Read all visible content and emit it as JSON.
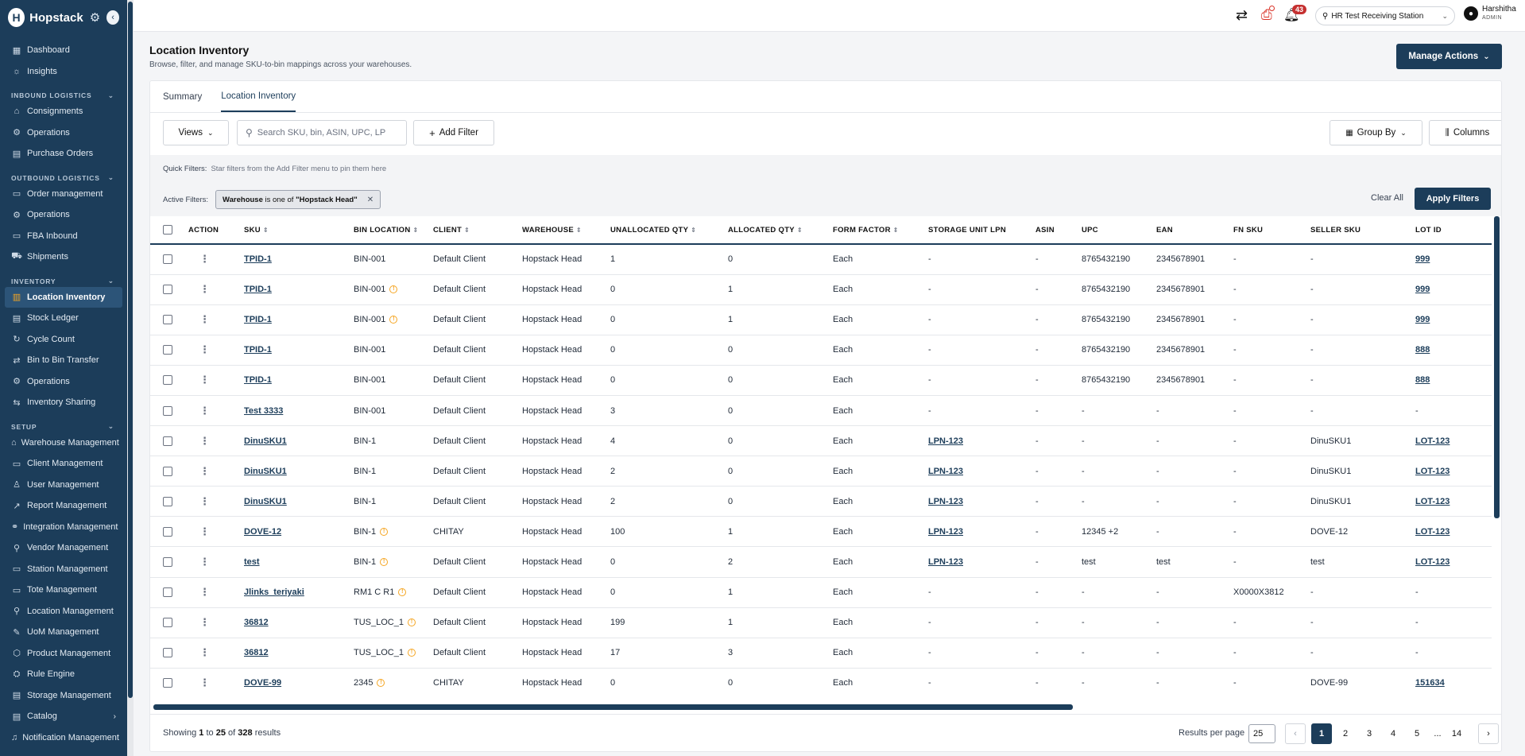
{
  "brand": {
    "name": "Hopstack"
  },
  "sidebar": {
    "top": [
      {
        "label": "Dashboard",
        "icon": "grid-icon"
      },
      {
        "label": "Insights",
        "icon": "bulb-icon"
      }
    ],
    "sections": [
      {
        "title": "INBOUND LOGISTICS",
        "items": [
          "Consignments",
          "Operations",
          "Purchase Orders"
        ]
      },
      {
        "title": "OUTBOUND LOGISTICS",
        "items": [
          "Order management",
          "Operations",
          "FBA Inbound",
          "Shipments"
        ]
      },
      {
        "title": "INVENTORY",
        "items": [
          "Location Inventory",
          "Stock Ledger",
          "Cycle Count",
          "Bin to Bin Transfer",
          "Operations",
          "Inventory Sharing"
        ]
      },
      {
        "title": "SETUP",
        "items": [
          "Warehouse Management",
          "Client Management",
          "User Management",
          "Report Management",
          "Integration Management",
          "Vendor Management",
          "Station Management",
          "Tote Management",
          "Location Management",
          "UoM Management",
          "Product Management",
          "Rule Engine",
          "Storage Management",
          "Catalog",
          "Notification Management"
        ]
      }
    ]
  },
  "topbar": {
    "notification_count": "43",
    "station": "HR Test Receiving Station",
    "user_name": "Harshitha",
    "user_role": "ADMIN"
  },
  "page": {
    "title": "Location Inventory",
    "subtitle": "Browse, filter, and manage SKU-to-bin mappings across your warehouses.",
    "manage_actions": "Manage Actions"
  },
  "tabs": [
    "Summary",
    "Location Inventory"
  ],
  "toolbar": {
    "views": "Views",
    "search_placeholder": "Search SKU, bin, ASIN, UPC, LP",
    "add_filter": "Add Filter",
    "group_by": "Group By",
    "columns": "Columns"
  },
  "filters": {
    "quick_label": "Quick Filters:",
    "quick_hint": "Star filters from the Add Filter menu to pin them here",
    "active_label": "Active Filters:",
    "chip_field": "Warehouse",
    "chip_op": "is one of",
    "chip_value": "\"Hopstack Head\"",
    "clear_all": "Clear All",
    "apply": "Apply Filters"
  },
  "table": {
    "headers": [
      "ACTION",
      "SKU",
      "BIN LOCATION",
      "CLIENT",
      "WAREHOUSE",
      "UNALLOCATED QTY",
      "ALLOCATED QTY",
      "FORM FACTOR",
      "STORAGE UNIT LPN",
      "ASIN",
      "UPC",
      "EAN",
      "FN SKU",
      "SELLER SKU",
      "LOT ID"
    ],
    "rows": [
      {
        "sku": "TPID-1",
        "bin": "BIN-001",
        "warn": false,
        "client": "Default Client",
        "warehouse": "Hopstack Head",
        "unalloc": "1",
        "alloc": "0",
        "form": "Each",
        "lpn": "-",
        "asin": "-",
        "upc": "8765432190",
        "ean": "2345678901",
        "fnsku": "-",
        "seller": "-",
        "lot": "999"
      },
      {
        "sku": "TPID-1",
        "bin": "BIN-001",
        "warn": true,
        "client": "Default Client",
        "warehouse": "Hopstack Head",
        "unalloc": "0",
        "alloc": "1",
        "form": "Each",
        "lpn": "-",
        "asin": "-",
        "upc": "8765432190",
        "ean": "2345678901",
        "fnsku": "-",
        "seller": "-",
        "lot": "999"
      },
      {
        "sku": "TPID-1",
        "bin": "BIN-001",
        "warn": true,
        "client": "Default Client",
        "warehouse": "Hopstack Head",
        "unalloc": "0",
        "alloc": "1",
        "form": "Each",
        "lpn": "-",
        "asin": "-",
        "upc": "8765432190",
        "ean": "2345678901",
        "fnsku": "-",
        "seller": "-",
        "lot": "999"
      },
      {
        "sku": "TPID-1",
        "bin": "BIN-001",
        "warn": false,
        "client": "Default Client",
        "warehouse": "Hopstack Head",
        "unalloc": "0",
        "alloc": "0",
        "form": "Each",
        "lpn": "-",
        "asin": "-",
        "upc": "8765432190",
        "ean": "2345678901",
        "fnsku": "-",
        "seller": "-",
        "lot": "888"
      },
      {
        "sku": "TPID-1",
        "bin": "BIN-001",
        "warn": false,
        "client": "Default Client",
        "warehouse": "Hopstack Head",
        "unalloc": "0",
        "alloc": "0",
        "form": "Each",
        "lpn": "-",
        "asin": "-",
        "upc": "8765432190",
        "ean": "2345678901",
        "fnsku": "-",
        "seller": "-",
        "lot": "888"
      },
      {
        "sku": "Test 3333",
        "bin": "BIN-001",
        "warn": false,
        "client": "Default Client",
        "warehouse": "Hopstack Head",
        "unalloc": "3",
        "alloc": "0",
        "form": "Each",
        "lpn": "-",
        "asin": "-",
        "upc": "-",
        "ean": "-",
        "fnsku": "-",
        "seller": "-",
        "lot": "-"
      },
      {
        "sku": "DinuSKU1",
        "bin": "BIN-1",
        "warn": false,
        "client": "Default Client",
        "warehouse": "Hopstack Head",
        "unalloc": "4",
        "alloc": "0",
        "form": "Each",
        "lpn": "LPN-123",
        "asin": "-",
        "upc": "-",
        "ean": "-",
        "fnsku": "-",
        "seller": "DinuSKU1",
        "lot": "LOT-123"
      },
      {
        "sku": "DinuSKU1",
        "bin": "BIN-1",
        "warn": false,
        "client": "Default Client",
        "warehouse": "Hopstack Head",
        "unalloc": "2",
        "alloc": "0",
        "form": "Each",
        "lpn": "LPN-123",
        "asin": "-",
        "upc": "-",
        "ean": "-",
        "fnsku": "-",
        "seller": "DinuSKU1",
        "lot": "LOT-123"
      },
      {
        "sku": "DinuSKU1",
        "bin": "BIN-1",
        "warn": false,
        "client": "Default Client",
        "warehouse": "Hopstack Head",
        "unalloc": "2",
        "alloc": "0",
        "form": "Each",
        "lpn": "LPN-123",
        "asin": "-",
        "upc": "-",
        "ean": "-",
        "fnsku": "-",
        "seller": "DinuSKU1",
        "lot": "LOT-123"
      },
      {
        "sku": "DOVE-12",
        "bin": "BIN-1",
        "warn": true,
        "client": "CHITAY",
        "warehouse": "Hopstack Head",
        "unalloc": "100",
        "alloc": "1",
        "form": "Each",
        "lpn": "LPN-123",
        "asin": "-",
        "upc": "12345 +2",
        "ean": "-",
        "fnsku": "-",
        "seller": "DOVE-12",
        "lot": "LOT-123"
      },
      {
        "sku": "test",
        "bin": "BIN-1",
        "warn": true,
        "client": "Default Client",
        "warehouse": "Hopstack Head",
        "unalloc": "0",
        "alloc": "2",
        "form": "Each",
        "lpn": "LPN-123",
        "asin": "-",
        "upc": "test",
        "ean": "test",
        "fnsku": "-",
        "seller": "test",
        "lot": "LOT-123"
      },
      {
        "sku": "Jlinks_teriyaki",
        "bin": "RM1 C R1",
        "warn": true,
        "client": "Default Client",
        "warehouse": "Hopstack Head",
        "unalloc": "0",
        "alloc": "1",
        "form": "Each",
        "lpn": "-",
        "asin": "-",
        "upc": "-",
        "ean": "-",
        "fnsku": "X0000X3812",
        "seller": "-",
        "lot": "-"
      },
      {
        "sku": "36812",
        "bin": "TUS_LOC_1",
        "warn": true,
        "client": "Default Client",
        "warehouse": "Hopstack Head",
        "unalloc": "199",
        "alloc": "1",
        "form": "Each",
        "lpn": "-",
        "asin": "-",
        "upc": "-",
        "ean": "-",
        "fnsku": "-",
        "seller": "-",
        "lot": "-"
      },
      {
        "sku": "36812",
        "bin": "TUS_LOC_1",
        "warn": true,
        "client": "Default Client",
        "warehouse": "Hopstack Head",
        "unalloc": "17",
        "alloc": "3",
        "form": "Each",
        "lpn": "-",
        "asin": "-",
        "upc": "-",
        "ean": "-",
        "fnsku": "-",
        "seller": "-",
        "lot": "-"
      },
      {
        "sku": "DOVE-99",
        "bin": "2345",
        "warn": true,
        "client": "CHITAY",
        "warehouse": "Hopstack Head",
        "unalloc": "0",
        "alloc": "0",
        "form": "Each",
        "lpn": "-",
        "asin": "-",
        "upc": "-",
        "ean": "-",
        "fnsku": "-",
        "seller": "DOVE-99",
        "lot": "151634"
      }
    ]
  },
  "footer": {
    "showing_prefix": "Showing",
    "from": "1",
    "to_word": "to",
    "to": "25",
    "of_word": "of",
    "total": "328",
    "suffix": "results",
    "rpp_label": "Results per page",
    "rpp_value": "25",
    "pages": [
      "1",
      "2",
      "3",
      "4",
      "5",
      "...",
      "14"
    ]
  }
}
